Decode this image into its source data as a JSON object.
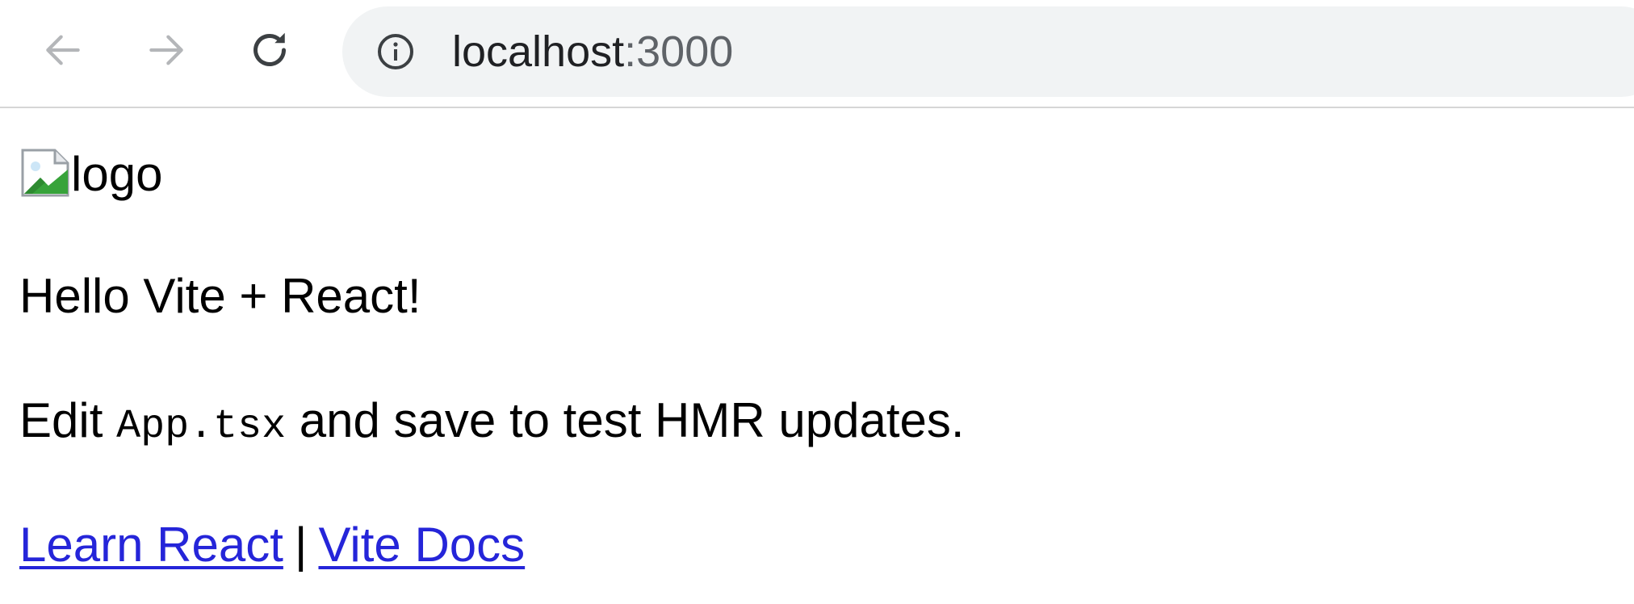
{
  "browser": {
    "url_host": "localhost",
    "url_port": ":3000",
    "icons": {
      "back": "arrow-left-icon",
      "forward": "arrow-right-icon",
      "reload": "reload-icon",
      "site_info": "info-icon"
    }
  },
  "page": {
    "logo_alt": "logo",
    "hello": "Hello Vite + React!",
    "edit_prefix": "Edit ",
    "edit_code": "App.tsx",
    "edit_suffix": " and save to test HMR updates.",
    "link_react": "Learn React",
    "separator": "|",
    "link_vite": "Vite Docs"
  },
  "colors": {
    "link": "#2525d9",
    "toolbar_border": "#d6d6d6",
    "omnibox_bg": "#f1f3f4"
  }
}
